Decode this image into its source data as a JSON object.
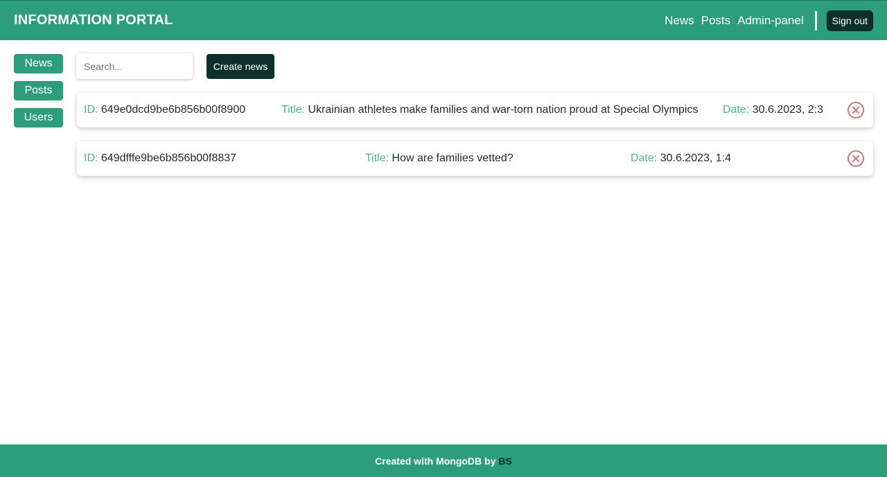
{
  "header": {
    "brand": "INFORMATION PORTAL",
    "nav": [
      "News",
      "Posts",
      "Admin-panel"
    ],
    "signout_label": "Sign out"
  },
  "sidebar": {
    "items": [
      {
        "label": "News"
      },
      {
        "label": "Posts"
      },
      {
        "label": "Users"
      }
    ]
  },
  "toolbar": {
    "search_placeholder": "Search...",
    "create_label": "Create news"
  },
  "news": {
    "labels": {
      "id": "ID:",
      "title": "Title:",
      "date": "Date:"
    },
    "items": [
      {
        "id": "649e0dcd9be6b856b00f8900",
        "title": "Ukrainian athletes make families and war-torn nation proud at Special Olympics",
        "date": "30.6.2023, 2:3"
      },
      {
        "id": "649dfffe9be6b856b00f8837",
        "title": "How are families vetted?",
        "date": "30.6.2023, 1:4"
      }
    ]
  },
  "footer": {
    "text": "Created with MongoDB by",
    "author": "BS"
  },
  "colors": {
    "primary": "#2c9f7a",
    "dark": "#0e302a",
    "label": "#4fb38f",
    "delete": "#c97a7a"
  }
}
